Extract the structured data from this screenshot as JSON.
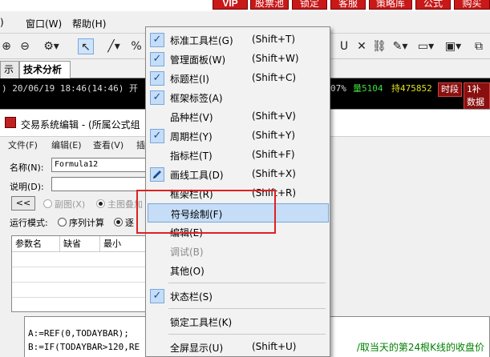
{
  "top_buttons": [
    {
      "label": "VIP"
    },
    {
      "label": "股票池"
    },
    {
      "label": "锁定"
    },
    {
      "label": "客服"
    },
    {
      "label": "策略库"
    },
    {
      "label": "公式"
    },
    {
      "label": "购买"
    }
  ],
  "menubar": {
    "window_label": "窗口(W)",
    "help_label": "帮助(H)"
  },
  "toolbar": {
    "percent": "%"
  },
  "tabs": [
    {
      "label": "示牌"
    },
    {
      "label": "技术分析"
    }
  ],
  "status": {
    "datetime": ") 20/06/19 18:46(14:46) 开",
    "pct": "07%",
    "volume": "量5104",
    "hold": "持475852",
    "segment_btn": "时段",
    "supplement_btn": "1补数据"
  },
  "editor": {
    "title": "交易系统编辑 - (所属公式组",
    "menu": [
      "文件(F)",
      "编辑(E)",
      "查看(V)",
      "插"
    ],
    "name_label": "名称(N):",
    "name_value": "Formula12",
    "desc_label": "说明(D):",
    "collapse_btn": "<<",
    "subchart_label": "副图(X)",
    "mainchart_label": "主图叠加",
    "run_mode_label": "运行模式:",
    "sequential_label": "序列计算",
    "stepwise_label": "逐",
    "param_headers": [
      "参数名",
      "缺省",
      "最小"
    ],
    "code_line1": "A:=REF(0,TODAYBAR);",
    "code_line2": "B:=IF(TODAYBAR>120,RE",
    "code_comment": "/取当天的第24根K线的收盘价"
  },
  "popup_menu": {
    "items": [
      {
        "label": "标准工具栏(G)",
        "shortcut": "(Shift+T)",
        "checked": true,
        "disabled": false
      },
      {
        "label": "管理面板(W)",
        "shortcut": "(Shift+W)",
        "checked": true,
        "disabled": false
      },
      {
        "label": "标题栏(I)",
        "shortcut": "(Shift+C)",
        "checked": true,
        "disabled": false
      },
      {
        "label": "框架标签(A)",
        "shortcut": "",
        "checked": true,
        "disabled": false
      },
      {
        "label": "品种栏(V)",
        "shortcut": "(Shift+V)",
        "checked": false,
        "disabled": false
      },
      {
        "label": "周期栏(Y)",
        "shortcut": "(Shift+Y)",
        "checked": true,
        "disabled": false
      },
      {
        "label": "指标栏(T)",
        "shortcut": "(Shift+F)",
        "checked": false,
        "disabled": false
      },
      {
        "label": "画线工具(D)",
        "shortcut": "(Shift+X)",
        "checked": false,
        "disabled": false
      },
      {
        "label": "框架栏(R)",
        "shortcut": "(Shift+R)",
        "checked": false,
        "disabled": false
      },
      {
        "label": "符号绘制(F)",
        "shortcut": "",
        "checked": false,
        "disabled": false
      },
      {
        "label": "编辑(E)",
        "shortcut": "",
        "checked": false,
        "disabled": false
      },
      {
        "label": "调试(B)",
        "shortcut": "",
        "checked": false,
        "disabled": true
      },
      {
        "label": "其他(O)",
        "shortcut": "",
        "checked": false,
        "disabled": false
      },
      {
        "label": "状态栏(S)",
        "shortcut": "",
        "checked": true,
        "disabled": false
      },
      {
        "label": "锁定工具栏(K)",
        "shortcut": "",
        "checked": false,
        "disabled": false
      },
      {
        "label": "全屏显示(U)",
        "shortcut": "(Shift+U)",
        "checked": false,
        "disabled": false
      }
    ]
  },
  "colors": {
    "highlight": "#c5ddf7",
    "annotation_box": "#e02020",
    "red_button": "#c81818"
  }
}
